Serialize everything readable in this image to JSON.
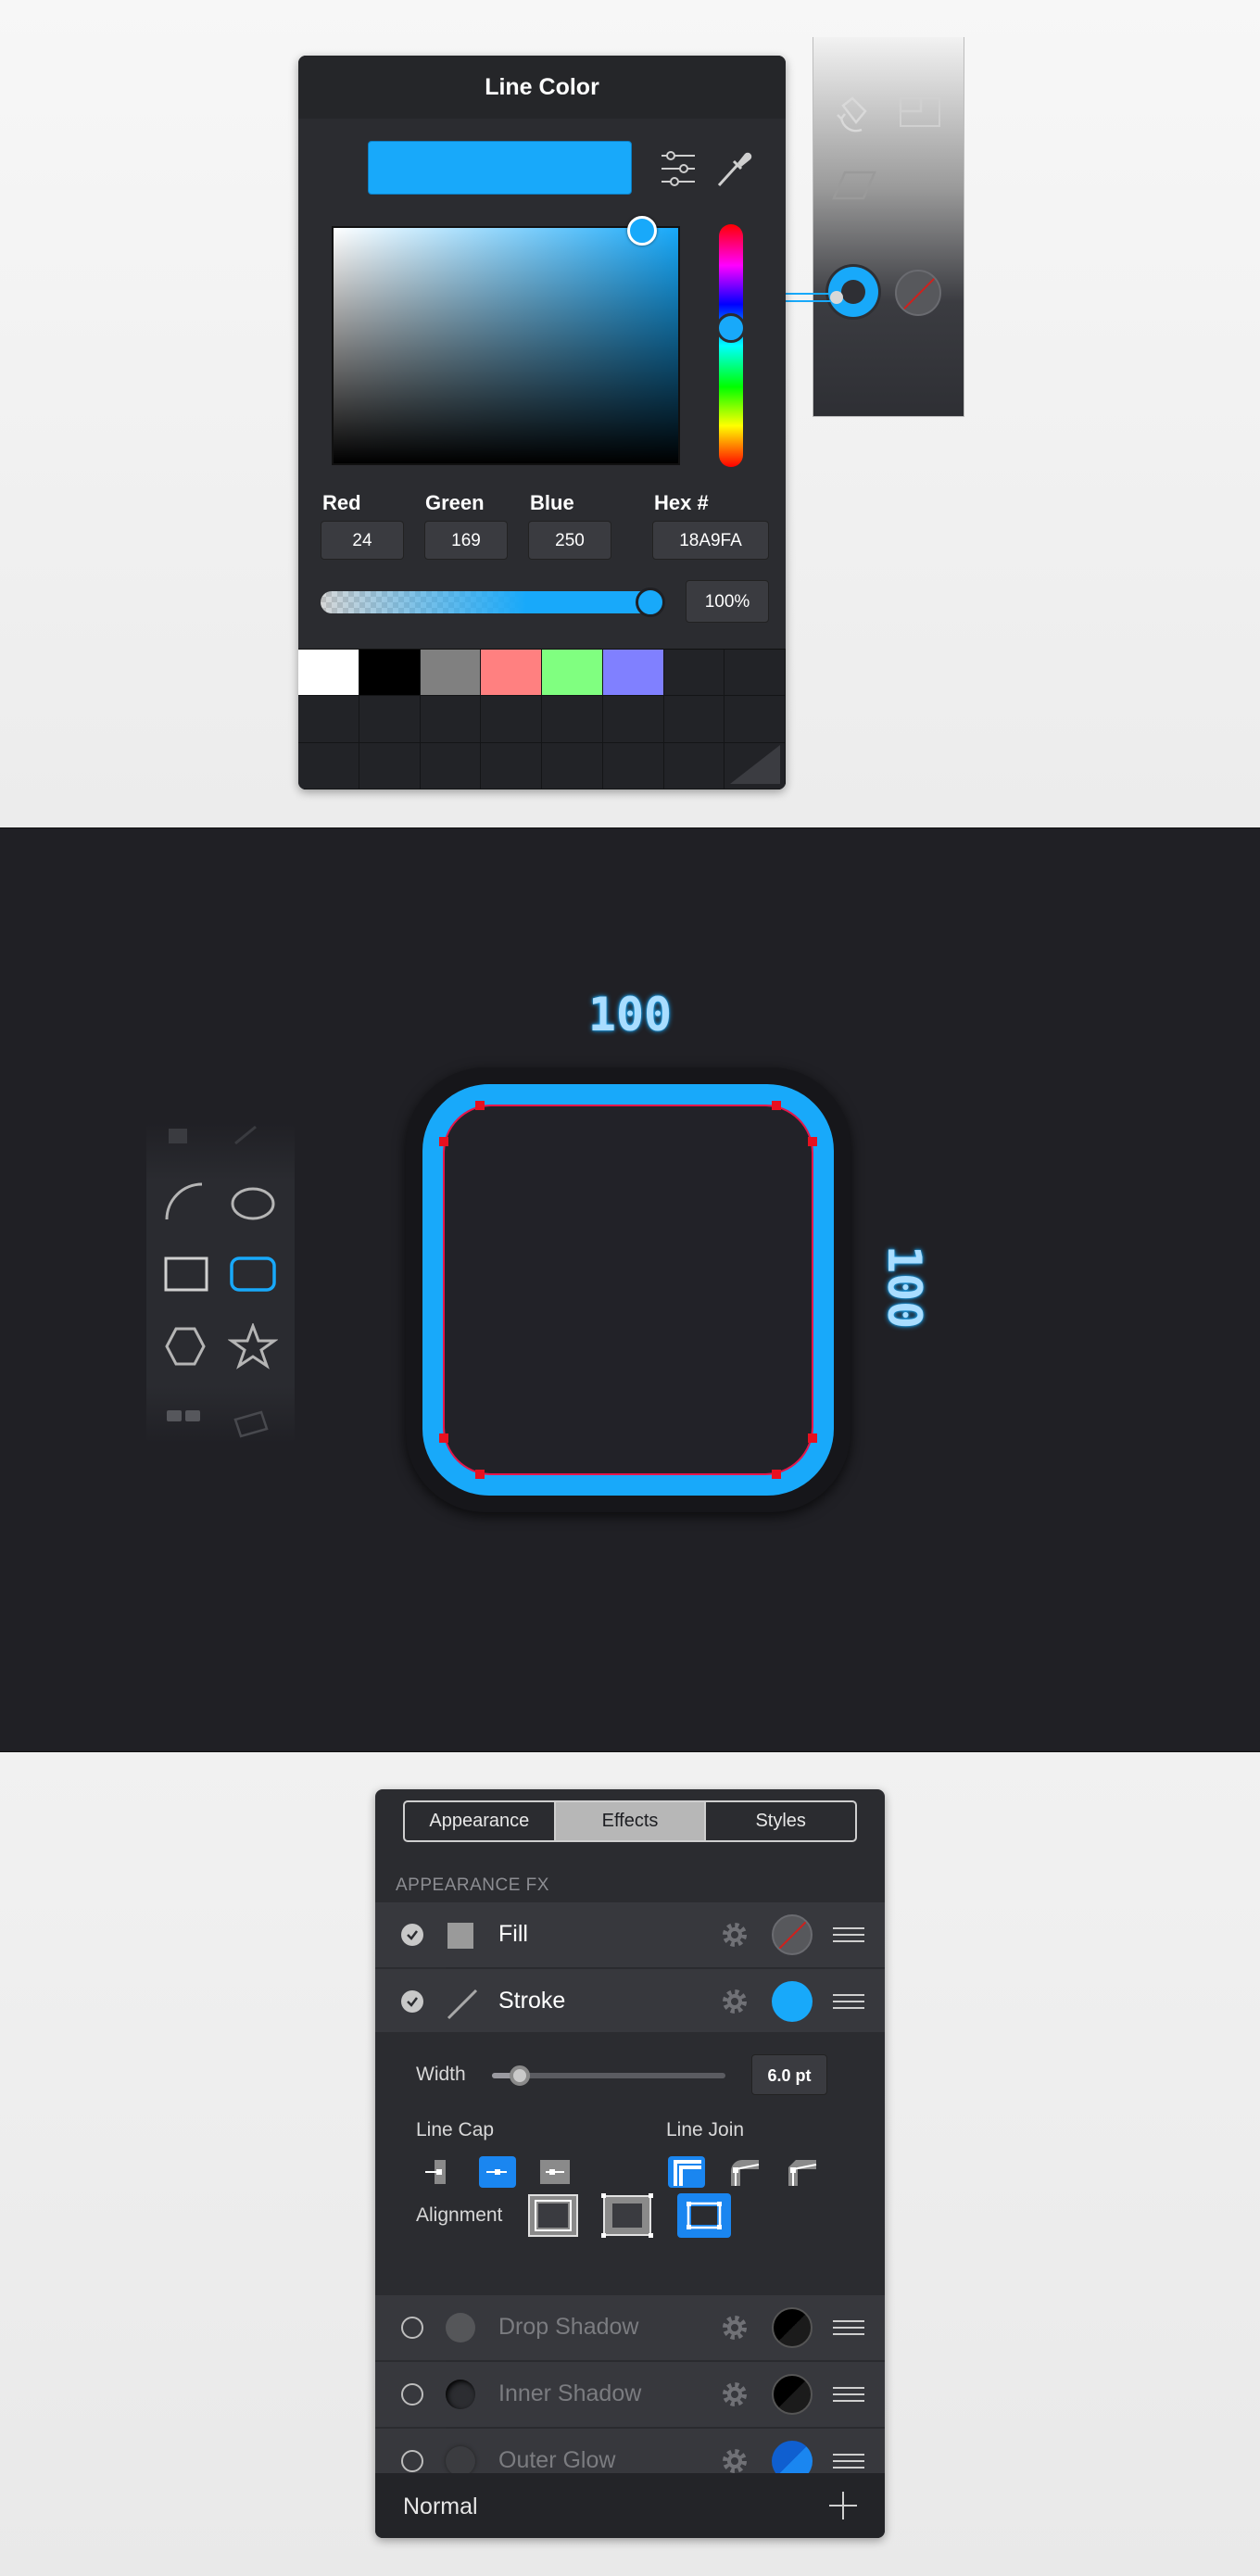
{
  "line_color_panel": {
    "title": "Line Color",
    "channels": [
      {
        "label": "Red",
        "value": "24"
      },
      {
        "label": "Green",
        "value": "169"
      },
      {
        "label": "Blue",
        "value": "250"
      },
      {
        "label": "Hex #",
        "value": "18A9FA"
      }
    ],
    "opacity": "100%",
    "opacity_fraction": 1.0,
    "current_color": "#18A9FA",
    "swatches": [
      "#FFFFFF",
      "#000000",
      "#808080",
      "#FF8080",
      "#80FF80",
      "#8080FF"
    ],
    "icons": [
      "color-sliders-icon",
      "eyedropper-icon",
      "resize-grip-icon"
    ]
  },
  "toolstrip": {
    "icons": [
      "rotate-icon",
      "align-icon",
      "skew-icon"
    ],
    "line_color_chip": "#18A9FA",
    "fill_chip": "none"
  },
  "canvas": {
    "width_label": "100",
    "height_label": "100",
    "stroke_color": "#18A9FA",
    "path_color": "#E6164A",
    "shape_tools": [
      "arc-tool-icon",
      "ellipse-tool-icon",
      "rectangle-tool-icon",
      "rounded-rectangle-tool-icon",
      "hexagon-tool-icon",
      "star-tool-icon"
    ],
    "selected_tool": "rounded-rectangle-tool-icon"
  },
  "effects_panel": {
    "tabs": [
      {
        "label": "Appearance",
        "active": false
      },
      {
        "label": "Effects",
        "active": true
      },
      {
        "label": "Styles",
        "active": false
      }
    ],
    "section_title": "APPEARANCE FX",
    "fx_items": [
      {
        "name": "Fill",
        "enabled": true,
        "color": "none"
      },
      {
        "name": "Stroke",
        "enabled": true,
        "color": "#18A9FA"
      },
      {
        "name": "Drop Shadow",
        "enabled": false,
        "color": "#000000"
      },
      {
        "name": "Inner Shadow",
        "enabled": false,
        "color": "#000000"
      },
      {
        "name": "Outer Glow",
        "enabled": false,
        "color": "#1A86F0"
      }
    ],
    "stroke": {
      "width_label": "Width",
      "width_value": "6.0 pt",
      "width_fraction": 0.12,
      "line_cap_label": "Line Cap",
      "line_join_label": "Line Join",
      "alignment_label": "Alignment",
      "line_cap_options": [
        "butt-cap-icon",
        "round-cap-icon",
        "square-cap-icon"
      ],
      "line_cap_selected": "round-cap-icon",
      "line_join_options": [
        "miter-join-icon",
        "round-join-icon",
        "bevel-join-icon"
      ],
      "line_join_selected": "miter-join-icon",
      "alignment_options": [
        "inside-align-icon",
        "center-align-icon",
        "outside-align-icon"
      ],
      "alignment_selected": "outside-align-icon"
    },
    "blend_mode": "Normal",
    "accent": "#1A86F0"
  }
}
